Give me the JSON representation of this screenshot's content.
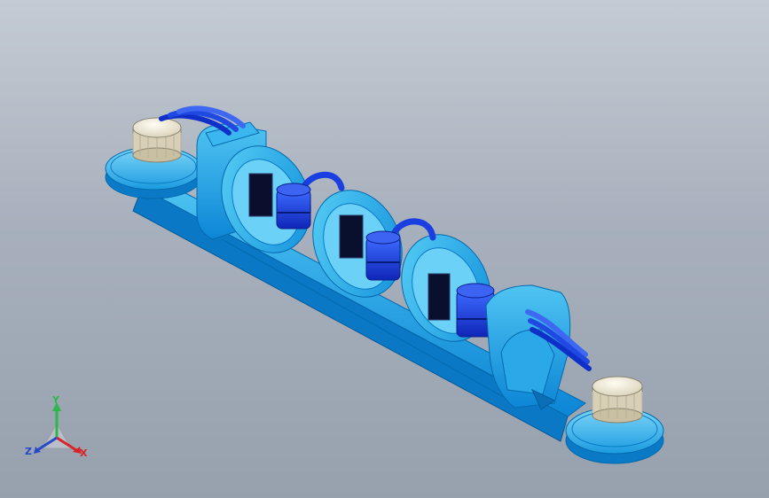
{
  "viewport": {
    "background_top": "#c4cbd4",
    "background_bottom": "#97a1ae",
    "model_color": "#1ea6e6",
    "model_dark": "#0c79c8",
    "part_blue": "#1238d8",
    "knob_color": "#efe9d6"
  },
  "triad": {
    "y_label": "Y",
    "x_label": "X",
    "z_label": "Z",
    "y_color": "#2db84a",
    "x_color": "#d8232a",
    "z_color": "#2a49c8"
  }
}
